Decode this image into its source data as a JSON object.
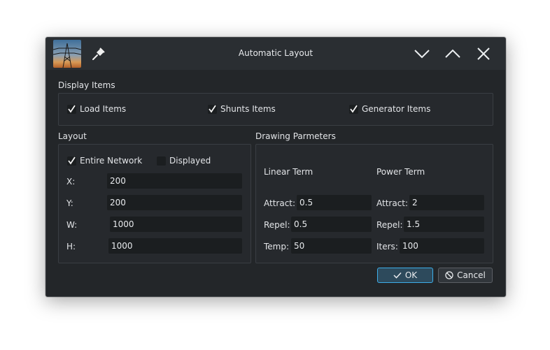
{
  "window": {
    "title": "Automatic Layout",
    "icons": {
      "app": "power-tower-icon",
      "pin": "pin-icon",
      "minimize": "chevron-down-icon",
      "maximize": "chevron-up-icon",
      "close": "close-icon"
    }
  },
  "display_items": {
    "label": "Display Items",
    "checkboxes": [
      {
        "label": "Load Items",
        "checked": true
      },
      {
        "label": "Shunts Items",
        "checked": true
      },
      {
        "label": "Generator Items",
        "checked": true
      }
    ]
  },
  "layout": {
    "label": "Layout",
    "entire_network": {
      "label": "Entire Network",
      "checked": true
    },
    "displayed": {
      "label": "Displayed",
      "checked": false
    },
    "fields": [
      {
        "label": "X:",
        "value": "200"
      },
      {
        "label": "Y:",
        "value": "200"
      },
      {
        "label": "W:",
        "value": "1000"
      },
      {
        "label": "H:",
        "value": "1000"
      }
    ]
  },
  "drawing": {
    "label": "Drawing Parmeters",
    "linear_term": {
      "heading": "Linear Term",
      "attract": {
        "label": "Attract:",
        "value": "0.5"
      },
      "repel": {
        "label": "Repel:",
        "value": "0.5"
      },
      "temp": {
        "label": "Temp:",
        "value": "50"
      }
    },
    "power_term": {
      "heading": "Power Term",
      "attract": {
        "label": "Attract:",
        "value": "2"
      },
      "repel": {
        "label": "Repel:",
        "value": "1.5"
      },
      "iters": {
        "label": "Iters:",
        "value": "100"
      }
    }
  },
  "buttons": {
    "ok": "OK",
    "cancel": "Cancel"
  },
  "colors": {
    "window_bg": "#232629",
    "accent": "#3daee9",
    "text": "#e3e5e8"
  }
}
